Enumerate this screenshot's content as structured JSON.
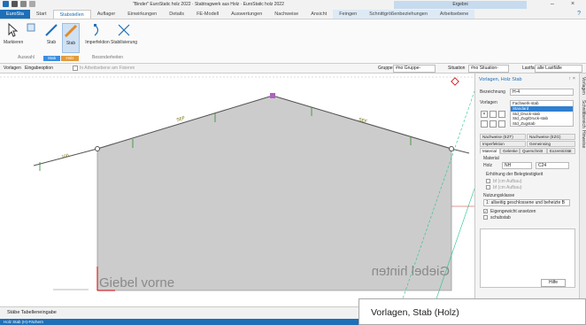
{
  "window": {
    "title": "\"Binder\" EuroStatic holz 2022 · Stabtragwerk aus Holz · EuroStatic holz 2022",
    "context_group": "Ergebni",
    "min": "–",
    "close": "×"
  },
  "tabs": [
    {
      "label": "EuroSta"
    },
    {
      "label": "Start"
    },
    {
      "label": "Stabstellen"
    },
    {
      "label": "Auflager"
    },
    {
      "label": "Einwirkungen"
    },
    {
      "label": "Details"
    },
    {
      "label": "FE-Modell"
    },
    {
      "label": "Auswertungen"
    },
    {
      "label": "Nachweise"
    },
    {
      "label": "Ansicht"
    },
    {
      "label": "Feingen"
    },
    {
      "label": "Schnittgrößenbeziehungen"
    },
    {
      "label": "Arbeitsebene"
    }
  ],
  "help": "?",
  "ribbon": {
    "buttons": {
      "markieren": "Markieren",
      "stab": "Stab",
      "stab2": "Stab",
      "imperfektion": "Imperfektion",
      "stabilisierung": "Stabilisierung"
    },
    "groups": {
      "auswahl": "Auswahl",
      "stab": "Stab",
      "holz": "Holz",
      "besonderheiten": "Besonderheiten"
    },
    "colors": {
      "stab_group": "#3b8de0",
      "holz_group": "#e39b3b"
    }
  },
  "toolbar": {
    "vorlagen": "Vorlagen",
    "eingabeoption": "Eingabeoption",
    "arbeitsebene": "In Arbeitsebene am Fixieren",
    "gruppe_label": "Gruppe",
    "gruppe_value": "#no Gruppe-",
    "situation_label": "Situation",
    "situation_value": "#no Situation-",
    "lastfall_label": "Lastfall",
    "lastfall_value": "alle Lastfälle"
  },
  "canvas": {
    "left_label": "Giebel vorne",
    "right_label": "Giebel hinten",
    "load_labels": [
      "100",
      "SEF",
      "SEF"
    ],
    "colors": {
      "fill": "#cccccc",
      "accent": "#d00000",
      "diag": "#22c48b"
    }
  },
  "panel": {
    "title": "Vorlagen, Holz Stab",
    "pin": "↑ ×",
    "bezeichnung_label": "Bezeichnung",
    "bezeichnung_value": "H-4",
    "vorlagen_label": "Vorlagen",
    "list": [
      "Fachwerk-stab",
      "Standard",
      "Std_Druck-stab",
      "Std_Zug/Druck-stab",
      "Std_Zugstab"
    ],
    "tabs_row1": [
      "Nachweise (EZT)",
      "Nachweise (EZG)"
    ],
    "tabs_row2": [
      "Imperfektion",
      "Gemeinsing"
    ],
    "tabs_row3": [
      "Material",
      "Gelenke",
      "Querschnitt",
      "Exzentrizität"
    ],
    "material_heading": "Material",
    "holz_label": "Holz",
    "holz_value": "NH",
    "klasse_value": "C24",
    "brandschutz_heading": "Erhöhung der Belegtestigkeit",
    "opt1": "bf (cm Aufbau)",
    "opt2": "bf (cm Aufbau)",
    "nutzung_heading": "Nutzungsklasse",
    "nutzung_value": "1: allseitig geschlossene und beheizte B",
    "eigengewicht": "Eigengewicht ansetzen",
    "schubstab": "schubstab",
    "help": "Hilfe"
  },
  "sidetabs": [
    "Vorlagen",
    "Schnittbereich",
    "Hinweise"
  ],
  "status": {
    "left": "Stäbe Tabelleneingabe",
    "bottom": "Holz Stab (H)-Fächern"
  },
  "tooltip": "Vorlagen, Stab (Holz)"
}
